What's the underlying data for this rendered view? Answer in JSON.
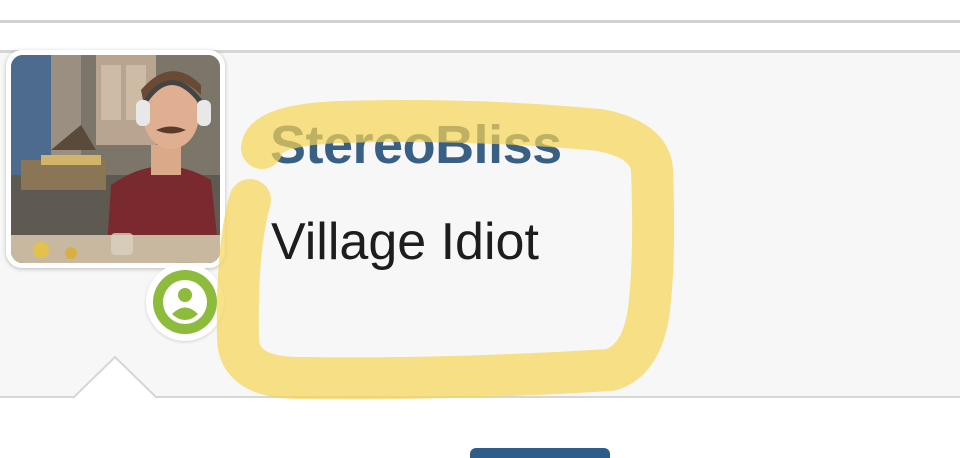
{
  "profile": {
    "username": "StereoBliss",
    "title": "Village Idiot",
    "presence_status": "online"
  },
  "colors": {
    "username": "#3a5f84",
    "presence_badge": "#8dbb3b",
    "highlighter": "#f6d455",
    "panel_background": "#f7f7f8"
  },
  "icons": {
    "presence": "person-icon"
  }
}
